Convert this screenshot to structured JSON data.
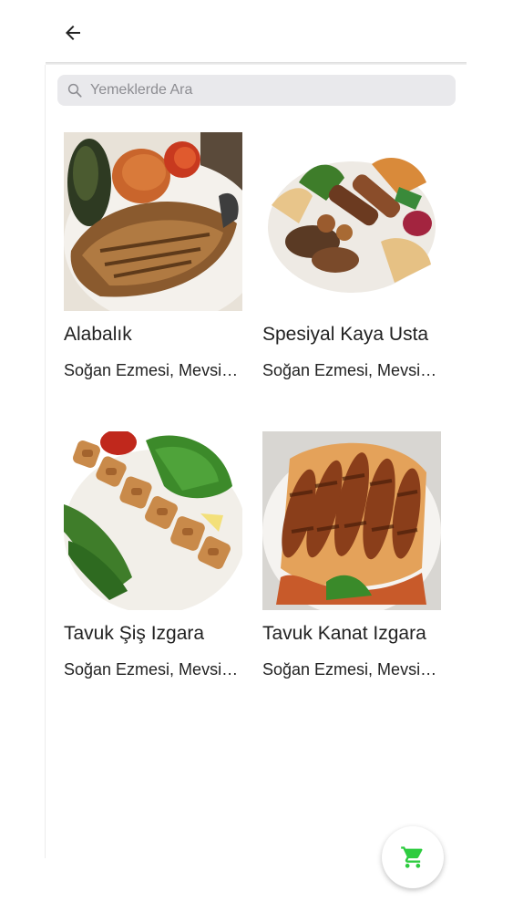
{
  "header": {
    "back_icon": "arrow-left-icon"
  },
  "search": {
    "placeholder": "Yemeklerde Ara",
    "value": "",
    "icon": "search-icon"
  },
  "products": [
    {
      "name": "Alabalık",
      "description": "Soğan Ezmesi, Mevsim Salata"
    },
    {
      "name": "Spesiyal Kaya Usta",
      "description": "Soğan Ezmesi, Mevsim Salata"
    },
    {
      "name": "Tavuk Şiş Izgara",
      "description": "Soğan Ezmesi, Mevsim Salata"
    },
    {
      "name": "Tavuk Kanat Izgara",
      "description": "Soğan Ezmesi, Mevsim Salata"
    }
  ],
  "cart": {
    "icon": "shopping-cart-icon",
    "color": "#2ecc40"
  }
}
